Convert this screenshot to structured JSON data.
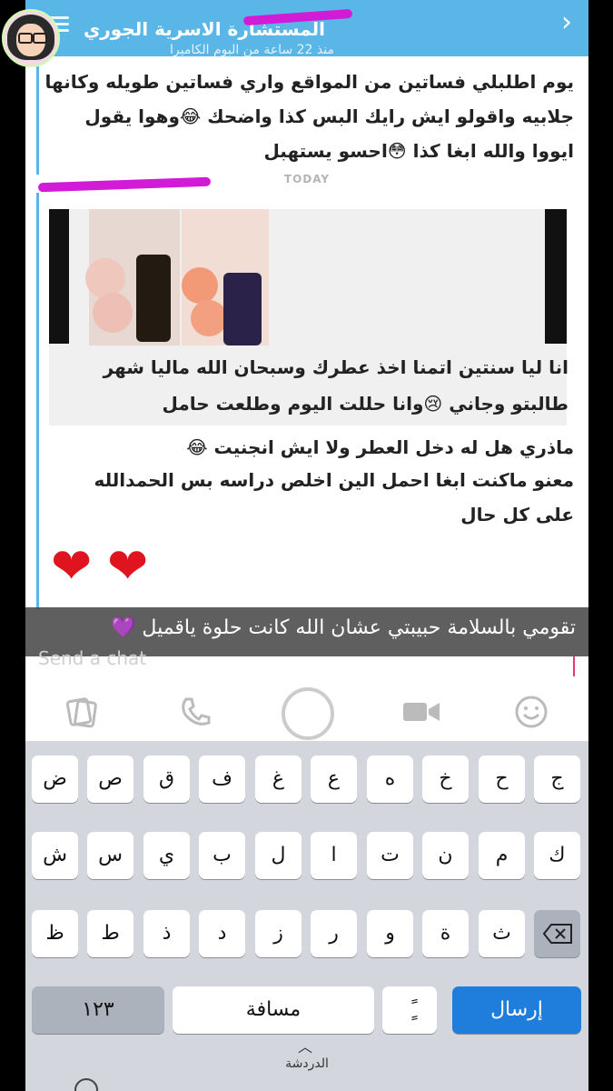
{
  "header": {
    "title": "المستشارة الاسرية الجوري",
    "subtitle": "منذ 22 ساعة من البوم الكاميرا"
  },
  "messages": {
    "earlier_lines": [
      "يوم اطلبلي فساتين من المواقع واري فساتين طويله وكانها",
      "جلابيه واقولو ايش رايك البس كذا واضحك 😂وهوا يقول",
      "ايووا والله ابغا كذا 😳احسو يستهبل"
    ],
    "day_divider": "TODAY",
    "snap_caption_lines": [
      "انا ليا سنتين اتمنا اخذ عطرك وسبحان الله ماليا شهر",
      "طالبتو وجاني 😢وانا حللت اليوم وطلعت حامل"
    ],
    "later_lines": [
      "ماذري هل له دخل العطر ولا ايش انجنيت 😂",
      "معنو ماكنت ابغا احمل الين اخلص دراسه بس الحمدالله",
      "على كل حال"
    ],
    "hearts": [
      "❤",
      "❤"
    ]
  },
  "overlay_caption": "تقومي بالسلامة حبيبتي  عشان الله كانت حلوة ياقميل 💜",
  "input": {
    "placeholder": "Send a chat"
  },
  "actions": {
    "sticker_icon": "sticker-icon",
    "call_icon": "phone-icon",
    "video_icon": "video-icon",
    "emoji_icon": "emoji-icon"
  },
  "keyboard": {
    "row1": [
      "ض",
      "ص",
      "ق",
      "ف",
      "غ",
      "ع",
      "ه",
      "خ",
      "ح",
      "ج"
    ],
    "row2": [
      "ش",
      "س",
      "ي",
      "ب",
      "ل",
      "ا",
      "ت",
      "ن",
      "م",
      "ك"
    ],
    "row3": [
      "ظ",
      "ط",
      "ذ",
      "د",
      "ز",
      "ر",
      "و",
      "ة",
      "ث"
    ],
    "numbers_label": "١٢٣",
    "space_label": "مسافة",
    "punct_label": "ًٍ",
    "send_label": "إرسال",
    "delete_icon": "backspace-icon"
  },
  "bottom": {
    "chat_label": "الدردشة"
  },
  "colors": {
    "header": "#5ab6e6",
    "accent_blue": "#1f7ddb",
    "scribble": "#d21bd6",
    "heart": "#e0141f"
  }
}
